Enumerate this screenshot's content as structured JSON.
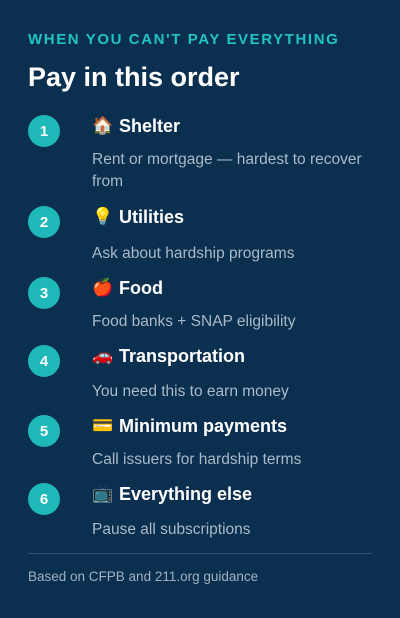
{
  "header": {
    "eyebrow": "WHEN YOU CAN'T PAY EVERYTHING",
    "title": "Pay in this order"
  },
  "steps": [
    {
      "number": "1",
      "icon": "🏠",
      "icon_name": "house-icon",
      "title": "Shelter",
      "description": "Rent or mortgage — hardest to recover from"
    },
    {
      "number": "2",
      "icon": "💡",
      "icon_name": "lightbulb-icon",
      "title": "Utilities",
      "description": "Ask about hardship programs"
    },
    {
      "number": "3",
      "icon": "🍎",
      "icon_name": "apple-icon",
      "title": "Food",
      "description": "Food banks + SNAP eligibility"
    },
    {
      "number": "4",
      "icon": "🚗",
      "icon_name": "car-icon",
      "title": "Transportation",
      "description": "You need this to earn money"
    },
    {
      "number": "5",
      "icon": "💳",
      "icon_name": "credit-card-icon",
      "title": "Minimum payments",
      "description": "Call issuers for hardship terms"
    },
    {
      "number": "6",
      "icon": "📺",
      "icon_name": "television-icon",
      "title": "Everything else",
      "description": "Pause all subscriptions"
    }
  ],
  "footer": {
    "source": "Based on CFPB and 211.org guidance"
  },
  "colors": {
    "background": "#0b2f4e",
    "accent": "#1fb8b8",
    "eyebrow": "#22c3c3",
    "muted_text": "#a9b9c9"
  }
}
